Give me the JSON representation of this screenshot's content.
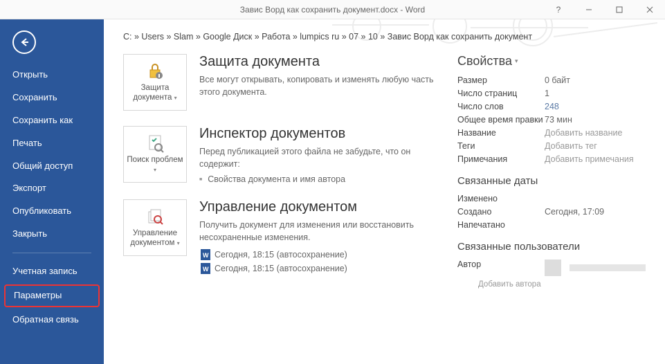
{
  "titlebar": {
    "title": "Завис Ворд как сохранить документ.docx - Word"
  },
  "sidebar": {
    "items": [
      "Открыть",
      "Сохранить",
      "Сохранить как",
      "Печать",
      "Общий доступ",
      "Экспорт",
      "Опубликовать",
      "Закрыть"
    ],
    "items2": [
      "Учетная запись",
      "Параметры",
      "Обратная связь"
    ]
  },
  "breadcrumb": "C: » Users » Slam » Google Диск » Работа » lumpics ru » 07 » 10 » Завис Ворд как сохранить документ",
  "sections": {
    "protect": {
      "tile": "Защита документа",
      "title": "Защита документа",
      "desc": "Все могут открывать, копировать и изменять любую часть этого документа."
    },
    "inspect": {
      "tile": "Поиск проблем",
      "title": "Инспектор документов",
      "desc": "Перед публикацией этого файла не забудьте, что он содержит:",
      "bullet": "Свойства документа и имя автора"
    },
    "manage": {
      "tile": "Управление документом",
      "title": "Управление документом",
      "desc": "Получить документ для изменения или восстановить несохраненные изменения.",
      "autosaves": [
        "Сегодня, 18:15 (автосохранение)",
        "Сегодня, 18:15 (автосохранение)"
      ]
    }
  },
  "props": {
    "heading": "Свойства",
    "rows": [
      {
        "label": "Размер",
        "value": "0 байт",
        "cls": ""
      },
      {
        "label": "Число страниц",
        "value": "1",
        "cls": ""
      },
      {
        "label": "Число слов",
        "value": "248",
        "cls": "link"
      },
      {
        "label": "Общее время правки",
        "value": "73 мин",
        "cls": ""
      },
      {
        "label": "Название",
        "value": "Добавить название",
        "cls": "add"
      },
      {
        "label": "Теги",
        "value": "Добавить тег",
        "cls": "add"
      },
      {
        "label": "Примечания",
        "value": "Добавить примечания",
        "cls": "add"
      }
    ],
    "dates_heading": "Связанные даты",
    "dates": [
      {
        "label": "Изменено",
        "value": ""
      },
      {
        "label": "Создано",
        "value": "Сегодня, 17:09"
      },
      {
        "label": "Напечатано",
        "value": ""
      }
    ],
    "users_heading": "Связанные пользователи",
    "author_label": "Автор",
    "add_author": "Добавить автора"
  }
}
